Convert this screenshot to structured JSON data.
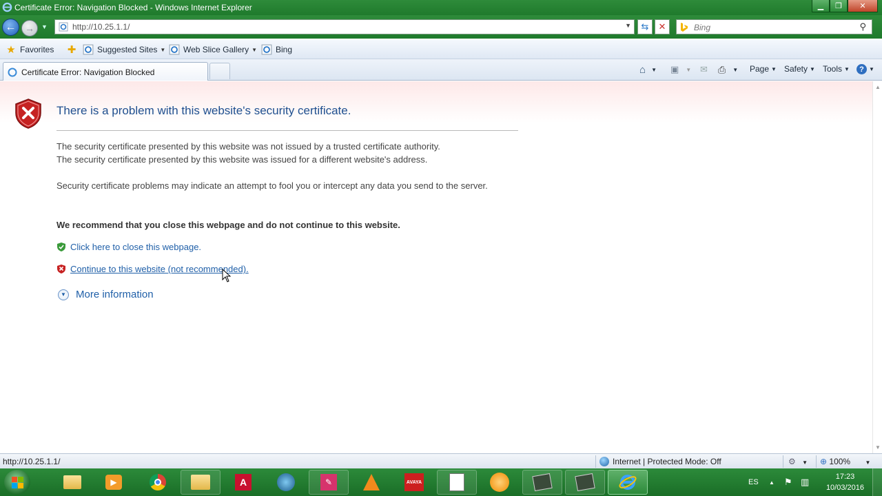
{
  "window": {
    "title": "Certificate Error: Navigation Blocked - Windows Internet Explorer",
    "buttons": {
      "minimize": "▁",
      "maximize": "❐",
      "close": "✕"
    }
  },
  "address_bar": {
    "url": "http://10.25.1.1/",
    "search_placeholder": "Bing"
  },
  "favorites_bar": {
    "favorites_label": "Favorites",
    "items": [
      {
        "label": "Suggested Sites",
        "icon": "ie-page-icon"
      },
      {
        "label": "Web Slice Gallery",
        "icon": "ie-page-icon"
      },
      {
        "label": "Bing",
        "icon": "ie-page-icon"
      }
    ]
  },
  "tab": {
    "label": "Certificate Error: Navigation Blocked"
  },
  "command_bar": {
    "page": "Page",
    "safety": "Safety",
    "tools": "Tools",
    "help": "?"
  },
  "page": {
    "heading": "There is a problem with this website's security certificate.",
    "para1_line1": "The security certificate presented by this website was not issued by a trusted certificate authority.",
    "para1_line2": "The security certificate presented by this website was issued for a different website's address.",
    "para2": "Security certificate problems may indicate an attempt to fool you or intercept any data you send to the server.",
    "recommendation": "We recommend that you close this webpage and do not continue to this website.",
    "close_link": "Click here to close this webpage.",
    "continue_link": "Continue to this website (not recommended).",
    "more_info": "More information"
  },
  "status_bar": {
    "url": "http://10.25.1.1/",
    "zone": "Internet | Protected Mode: Off",
    "zoom": "100%"
  },
  "taskbar": {
    "language": "ES",
    "time": "17:23",
    "date": "10/03/2016"
  },
  "colors": {
    "titlebar": "#1f7a2c",
    "link": "#1f5fa8",
    "heading": "#1f4f8f"
  }
}
